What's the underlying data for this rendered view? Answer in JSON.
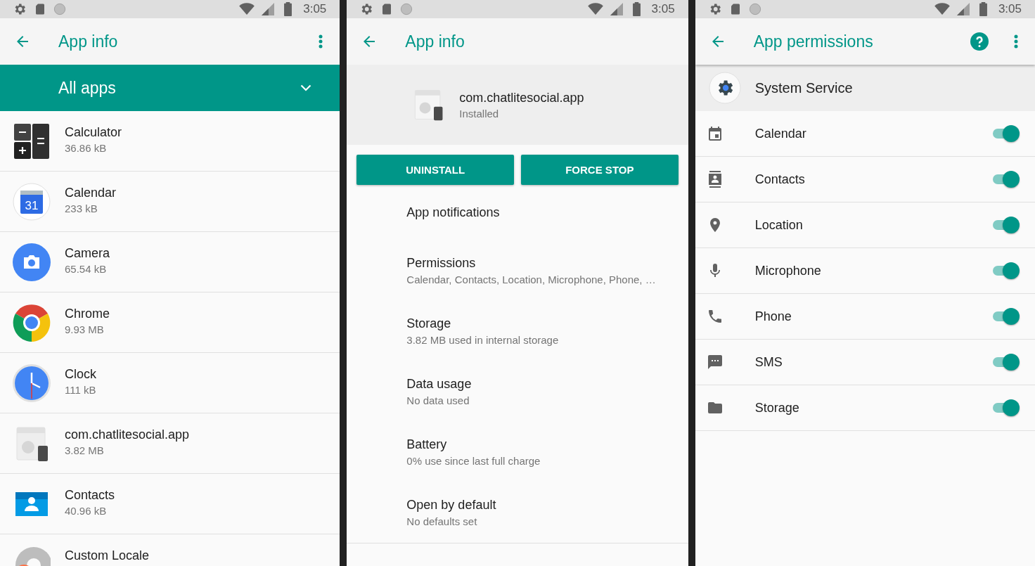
{
  "screens": [
    {
      "kind": "app_list",
      "status_bar": {
        "time": "3:05"
      },
      "toolbar": {
        "title": "App info",
        "menu": true
      },
      "filter": {
        "label": "All apps"
      },
      "apps": [
        {
          "name": "Calculator",
          "size": "36.86 kB",
          "kind": "calculator"
        },
        {
          "name": "Calendar",
          "size": "233 kB",
          "kind": "calendar",
          "icon_text": "31"
        },
        {
          "name": "Camera",
          "size": "65.54 kB",
          "kind": "camera"
        },
        {
          "name": "Chrome",
          "size": "9.93 MB",
          "kind": "browser"
        },
        {
          "name": "Clock",
          "size": "111 kB",
          "kind": "clock"
        },
        {
          "name": "com.chatlitesocial.app",
          "size": "3.82 MB",
          "kind": "generic"
        },
        {
          "name": "Contacts",
          "size": "40.96 kB",
          "kind": "contacts"
        },
        {
          "name": "Custom Locale",
          "kind": "locale"
        }
      ]
    },
    {
      "kind": "app_info",
      "status_bar": {
        "time": "3:05"
      },
      "toolbar": {
        "title": "App info"
      },
      "app": {
        "name": "com.chatlitesocial.app",
        "status": "Installed"
      },
      "buttons": [
        "UNINSTALL",
        "FORCE STOP"
      ],
      "items": [
        {
          "title": "App notifications"
        },
        {
          "title": "Permissions",
          "summary": "Calendar, Contacts, Location, Microphone, Phone, …"
        },
        {
          "title": "Storage",
          "summary": "3.82 MB used in internal storage"
        },
        {
          "title": "Data usage",
          "summary": "No data used"
        },
        {
          "title": "Battery",
          "summary": "0% use since last full charge"
        },
        {
          "title": "Open by default",
          "summary": "No defaults set"
        }
      ]
    },
    {
      "kind": "permissions",
      "status_bar": {
        "time": "3:05"
      },
      "toolbar": {
        "title": "App permissions",
        "help": true,
        "menu": true
      },
      "app": {
        "name": "System Service"
      },
      "permissions": [
        {
          "name": "Calendar",
          "kind": "calendar",
          "on": true
        },
        {
          "name": "Contacts",
          "kind": "contacts",
          "on": true
        },
        {
          "name": "Location",
          "kind": "location",
          "on": true
        },
        {
          "name": "Microphone",
          "kind": "microphone",
          "on": true
        },
        {
          "name": "Phone",
          "kind": "phone",
          "on": true
        },
        {
          "name": "SMS",
          "kind": "sms",
          "on": true
        },
        {
          "name": "Storage",
          "kind": "storage",
          "on": true
        }
      ]
    }
  ]
}
